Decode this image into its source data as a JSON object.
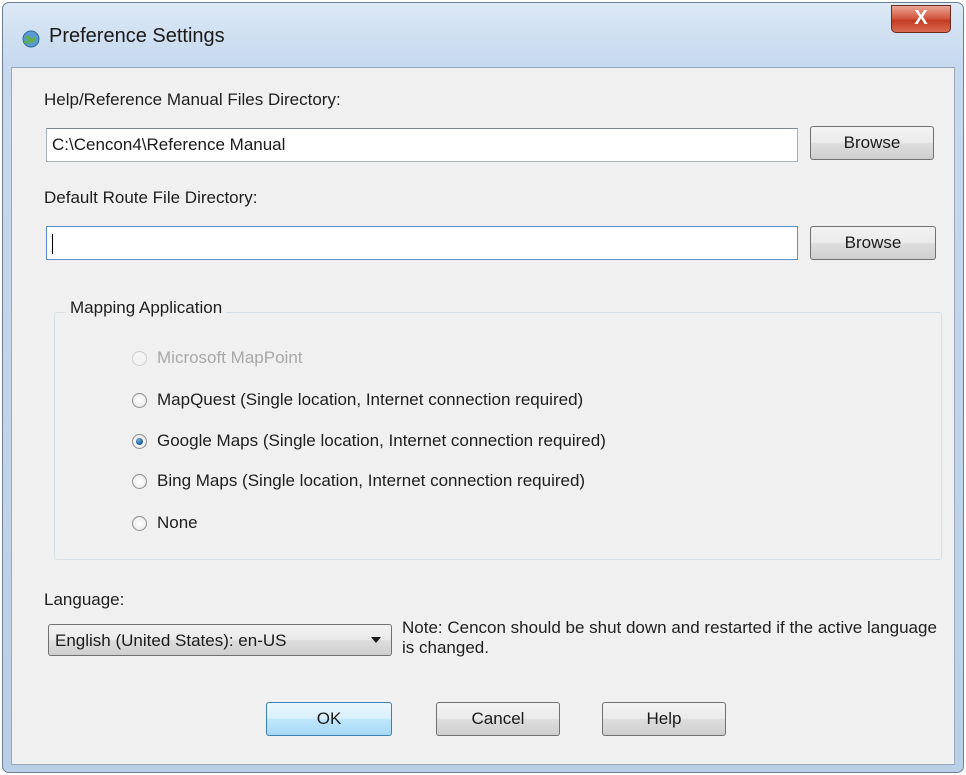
{
  "window": {
    "title": "Preference Settings",
    "close_glyph": "X",
    "app_icon": "globe-icon"
  },
  "help_dir": {
    "label": "Help/Reference Manual Files Directory:",
    "value": "C:\\Cencon4\\Reference Manual",
    "browse_label": "Browse"
  },
  "route_dir": {
    "label": "Default Route File Directory:",
    "value": "",
    "browse_label": "Browse"
  },
  "mapping": {
    "group_title": "Mapping Application",
    "options": [
      {
        "label": "Microsoft MapPoint",
        "checked": false,
        "disabled": true
      },
      {
        "label": "MapQuest (Single location, Internet connection required)",
        "checked": false,
        "disabled": false
      },
      {
        "label": "Google Maps (Single location, Internet connection required)",
        "checked": true,
        "disabled": false
      },
      {
        "label": "Bing Maps (Single location, Internet connection required)",
        "checked": false,
        "disabled": false
      },
      {
        "label": "None",
        "checked": false,
        "disabled": false
      }
    ]
  },
  "language": {
    "label": "Language:",
    "selected": "English (United States):  en-US",
    "note": "Note: Cencon should be shut down and restarted if the active language is changed."
  },
  "buttons": {
    "ok": "OK",
    "cancel": "Cancel",
    "help": "Help"
  }
}
